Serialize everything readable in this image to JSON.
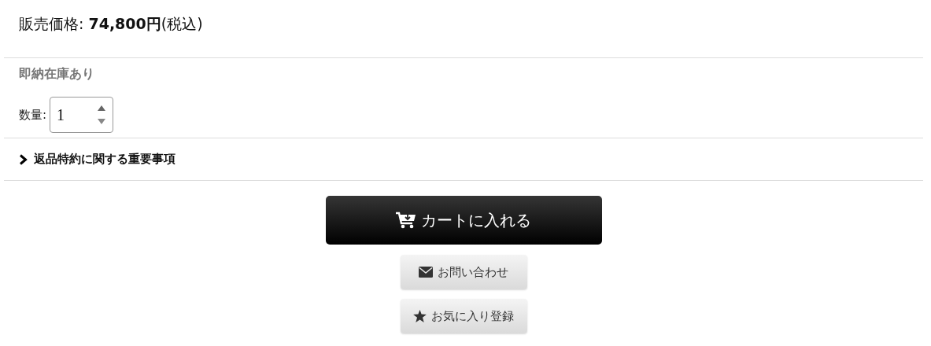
{
  "price": {
    "text": "販売価格: **74,800円**(税込)"
  },
  "stock": {
    "text": "即納在庫あり"
  },
  "quantity": {
    "label": "数量:",
    "value": "1"
  },
  "notice": {
    "label": "返品特約に関する重要事項",
    "expanded": false
  },
  "buttons": [
    {
      "kind": "cart",
      "label": "カートに入れる"
    },
    {
      "kind": "contact",
      "label": "お問い合わせ"
    },
    {
      "kind": "favorite",
      "label": "お気に入り登録"
    }
  ]
}
